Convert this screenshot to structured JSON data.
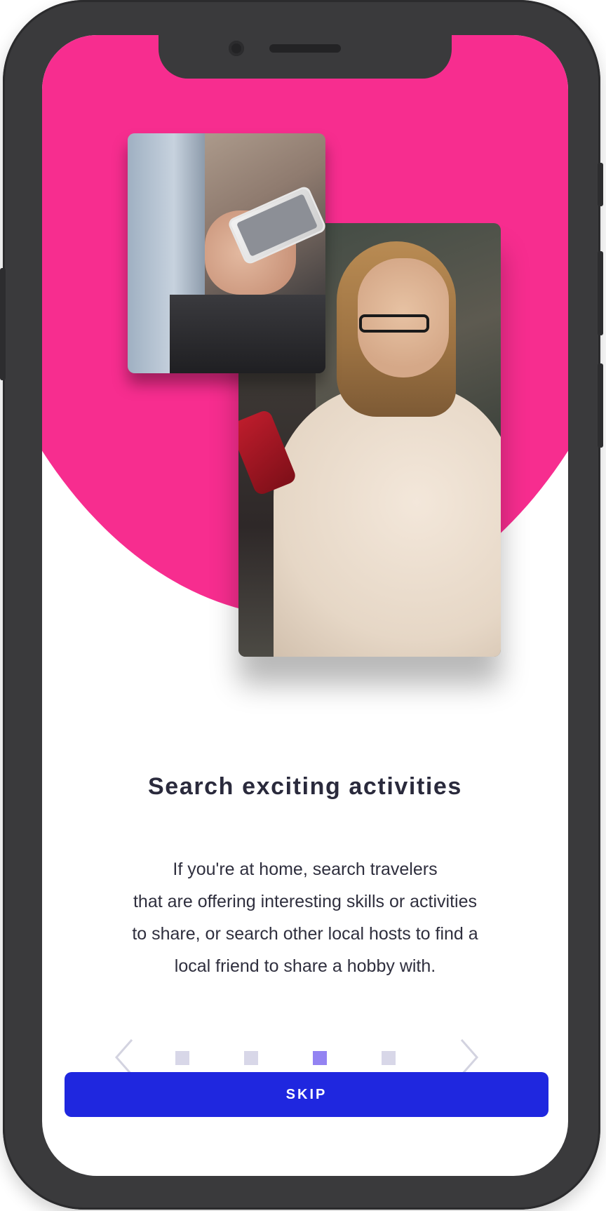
{
  "colors": {
    "hero_pink": "#f72d8f",
    "primary_button": "#1f27df",
    "dot_active": "#9383f2",
    "dot_inactive": "#d8d7e8",
    "arrow": "#d3d3e0",
    "title_text": "#2a2a3c"
  },
  "onboarding": {
    "title": "Search exciting activities",
    "description_lines": [
      "If you're at home, search travelers",
      "that are offering interesting skills or activities",
      "to share, or search other local hosts to find a",
      "local friend to share a hobby with."
    ],
    "current_step": 3,
    "total_steps": 4
  },
  "pager": {
    "prev_icon": "chevron-left-icon",
    "next_icon": "chevron-right-icon"
  },
  "actions": {
    "skip_label": "SKIP"
  }
}
